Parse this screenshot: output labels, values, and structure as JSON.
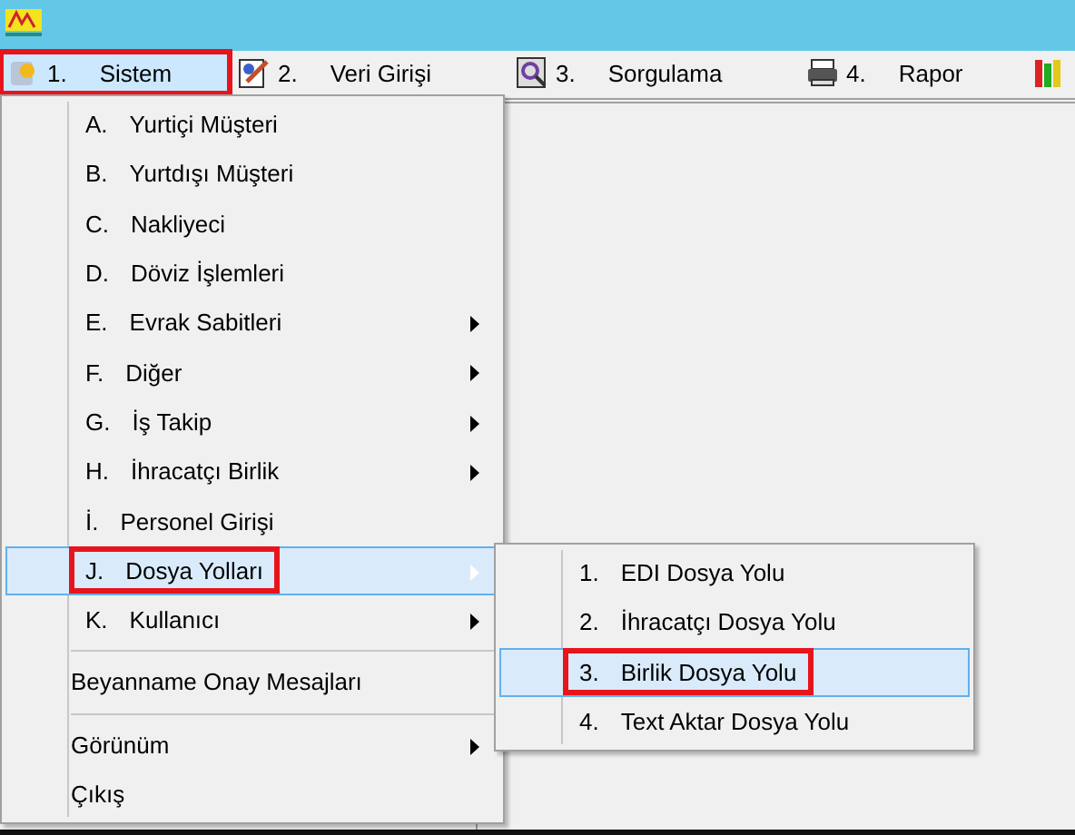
{
  "menu_bar": [
    {
      "key": "1.",
      "label": "Sistem",
      "selected": true,
      "highlighted": true
    },
    {
      "key": "2.",
      "label": "Veri Girişi",
      "selected": false,
      "highlighted": false
    },
    {
      "key": "3.",
      "label": "Sorgulama",
      "selected": false,
      "highlighted": false
    },
    {
      "key": "4.",
      "label": "Rapor",
      "selected": false,
      "highlighted": false
    }
  ],
  "dropdown": {
    "items": [
      {
        "kind": "item",
        "key": "A.",
        "label": "Yurtiçi Müşteri",
        "submenu": false,
        "selected": false,
        "highlighted": false
      },
      {
        "kind": "item",
        "key": "B.",
        "label": "Yurtdışı Müşteri",
        "submenu": false,
        "selected": false,
        "highlighted": false
      },
      {
        "kind": "item",
        "key": "C.",
        "label": "Nakliyeci",
        "submenu": false,
        "selected": false,
        "highlighted": false
      },
      {
        "kind": "item",
        "key": "D.",
        "label": "Döviz İşlemleri",
        "submenu": false,
        "selected": false,
        "highlighted": false
      },
      {
        "kind": "item",
        "key": "E.",
        "label": "Evrak Sabitleri",
        "submenu": true,
        "selected": false,
        "highlighted": false
      },
      {
        "kind": "item",
        "key": "F.",
        "label": "Diğer",
        "submenu": true,
        "selected": false,
        "highlighted": false
      },
      {
        "kind": "item",
        "key": "G.",
        "label": "İş Takip",
        "submenu": true,
        "selected": false,
        "highlighted": false
      },
      {
        "kind": "item",
        "key": "H.",
        "label": "İhracatçı Birlik",
        "submenu": true,
        "selected": false,
        "highlighted": false
      },
      {
        "kind": "item",
        "key": "İ.",
        "label": "Personel Girişi",
        "submenu": false,
        "selected": false,
        "highlighted": false
      },
      {
        "kind": "item",
        "key": "J.",
        "label": "Dosya Yolları",
        "submenu": true,
        "selected": true,
        "highlighted": true
      },
      {
        "kind": "item",
        "key": "K.",
        "label": "Kullanıcı",
        "submenu": true,
        "selected": false,
        "highlighted": false
      },
      {
        "kind": "separator"
      },
      {
        "kind": "item",
        "label": "Beyanname Onay Mesajları",
        "submenu": false,
        "selected": false,
        "highlighted": false
      },
      {
        "kind": "separator"
      },
      {
        "kind": "item",
        "label": "Görünüm",
        "submenu": true,
        "selected": false,
        "highlighted": false
      },
      {
        "kind": "item",
        "label": "Çıkış",
        "submenu": false,
        "selected": false,
        "highlighted": false
      }
    ]
  },
  "submenu": {
    "items": [
      {
        "key": "1.",
        "label": "EDI Dosya Yolu",
        "selected": false,
        "highlighted": false
      },
      {
        "key": "2.",
        "label": "İhracatçı Dosya Yolu",
        "selected": false,
        "highlighted": false
      },
      {
        "key": "3.",
        "label": "Birlik Dosya Yolu",
        "selected": true,
        "highlighted": true
      },
      {
        "key": "4.",
        "label": "Text Aktar Dosya Yolu",
        "selected": false,
        "highlighted": false
      }
    ]
  }
}
